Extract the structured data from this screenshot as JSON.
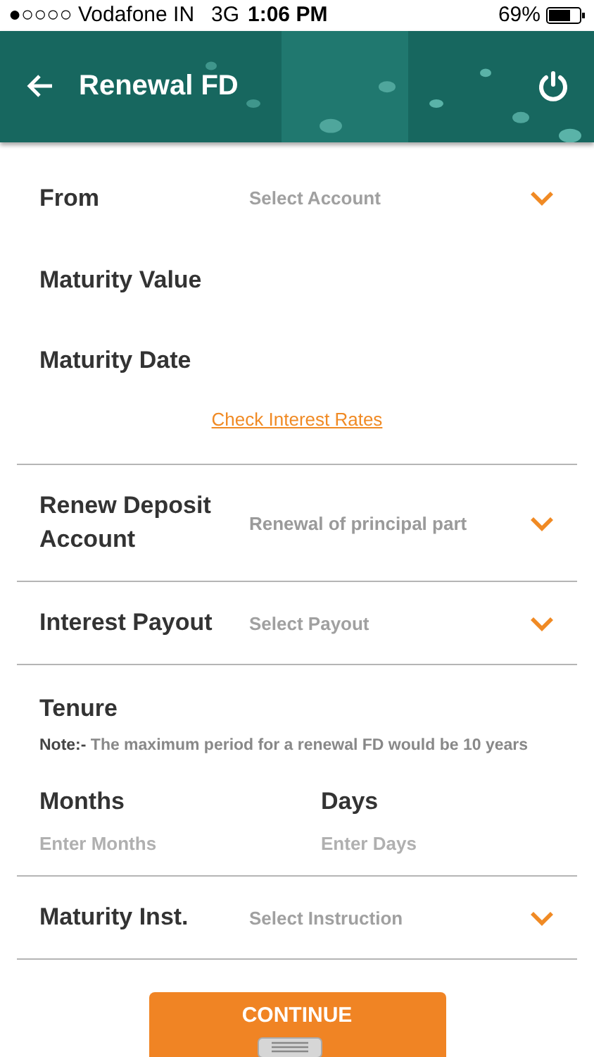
{
  "status_bar": {
    "carrier": "●○○○○ Vodafone IN",
    "network": "3G",
    "time": "1:06 PM",
    "battery": "69%"
  },
  "header": {
    "title": "Renewal FD"
  },
  "sections": [
    {
      "rows": [
        {
          "kind": "dropdown",
          "label": "From",
          "placeholder": "Select Account"
        },
        {
          "kind": "display",
          "label": "Maturity Value"
        },
        {
          "kind": "display",
          "label": "Maturity Date"
        },
        {
          "kind": "link",
          "text": "Check Interest Rates"
        }
      ]
    },
    {
      "rows": [
        {
          "kind": "dropdown",
          "label": "Renew Deposit Account",
          "value": "Renewal of principal part"
        }
      ]
    },
    {
      "rows": [
        {
          "kind": "dropdown",
          "label": "Interest Payout",
          "placeholder": "Select Payout"
        }
      ]
    },
    {
      "rows": [
        {
          "kind": "tenure",
          "label": "Tenure",
          "note": "**Note:-** The maximum period for a renewal FD would be 10 years",
          "inputs": [
            {
              "label": "Months",
              "placeholder": "Enter Months"
            },
            {
              "label": "Days",
              "placeholder": "Enter Days"
            }
          ]
        }
      ]
    },
    {
      "rows": [
        {
          "kind": "dropdown",
          "label": "Maturity Inst.",
          "placeholder": "Select Instruction"
        }
      ]
    }
  ],
  "button": {
    "label": "CONTINUE"
  }
}
